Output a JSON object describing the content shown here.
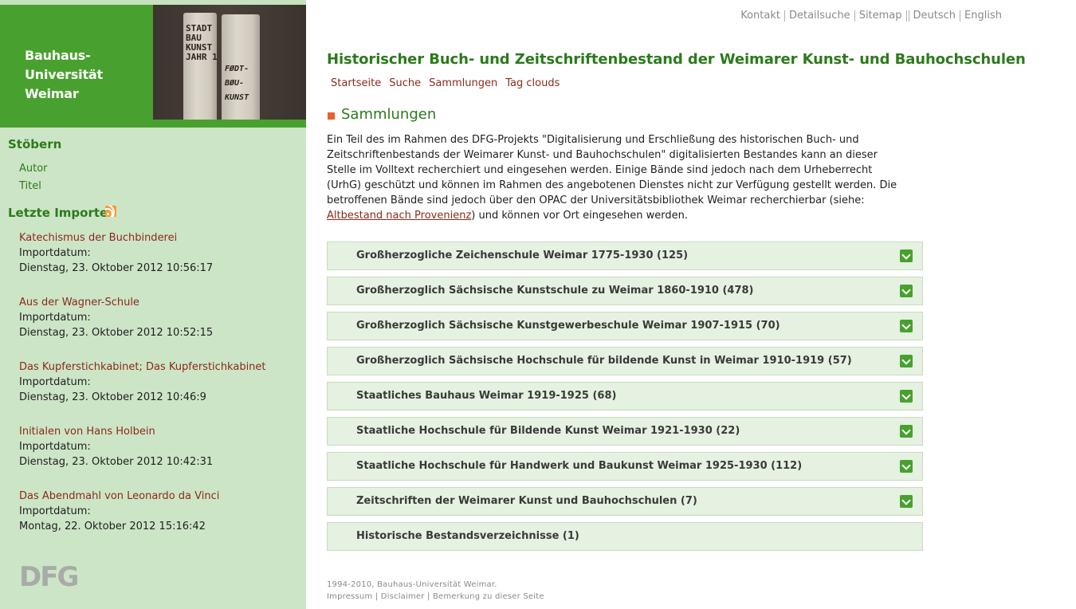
{
  "logo": {
    "text_line1": "Bauhaus-",
    "text_line2": "Universität",
    "text_line3": "Weimar",
    "photo_spine1": "STADT BAU KUNST JAHR 1",
    "photo_spine2": "FØDT- BØU- KUNST",
    "dfg": "DFG"
  },
  "colors": {
    "brand_green": "#48a12e",
    "sidebar_bg": "#cde5c7",
    "heading_green": "#2c7a1c",
    "link_red": "#8b2a1a",
    "bullet_orange": "#e8612c",
    "row_bg": "#e5f1e1"
  },
  "sidebar": {
    "browse_heading": "Stöbern",
    "browse_links": [
      "Autor",
      "Titel"
    ],
    "imports_heading": "Letzte Importe",
    "rss_icon": "rss-feed-icon",
    "imports": [
      {
        "title": "Katechismus der Buchbinderei",
        "label": "Importdatum:",
        "date": "Dienstag, 23. Oktober 2012 10:56:17"
      },
      {
        "title": "Aus der Wagner-Schule",
        "label": "Importdatum:",
        "date": "Dienstag, 23. Oktober 2012 10:52:15"
      },
      {
        "title": "Das Kupferstichkabinet; Das Kupferstichkabinet",
        "label": "Importdatum:",
        "date": "Dienstag, 23. Oktober 2012 10:46:9"
      },
      {
        "title": "Initialen von Hans Holbein",
        "label": "Importdatum:",
        "date": "Dienstag, 23. Oktober 2012 10:42:31"
      },
      {
        "title": "Das Abendmahl von Leonardo da Vinci",
        "label": "Importdatum:",
        "date": "Montag, 22. Oktober 2012 15:16:42"
      }
    ]
  },
  "top_nav": [
    "Kontakt",
    "Detailsuche",
    "Sitemap",
    "Deutsch",
    "English"
  ],
  "main": {
    "title": "Historischer Buch- und Zeitschriftenbestand der Weimarer Kunst- und Bauhochschulen",
    "breadcrumb": [
      "Startseite",
      "Suche",
      "Sammlungen",
      "Tag clouds"
    ],
    "section_title": "Sammlungen",
    "intro_before_link": "Ein Teil des im Rahmen des DFG-Projekts \"Digitalisierung und Erschließung des historischen Buch- und Zeitschriftenbestands der Weimarer Kunst- und Bauhochschulen\" digitalisierten Bestandes kann an dieser Stelle im Volltext recherchiert und eingesehen werden. Einige Bände sind jedoch nach dem Urheberrecht (UrhG) geschützt und können im Rahmen des angebotenen Dienstes nicht zur Verfügung gestellt werden. Die betroffenen Bände sind jedoch über den OPAC der Universitätsbibliothek Weimar recherchierbar (siehe: ",
    "intro_link": "Altbestand nach Provenienz",
    "intro_after_link": ") und können vor Ort eingesehen werden.",
    "collections": [
      {
        "label": "Großherzogliche Zeichenschule Weimar 1775-1930 (125)",
        "expandable": true
      },
      {
        "label": "Großherzoglich Sächsische Kunstschule zu Weimar 1860-1910 (478)",
        "expandable": true
      },
      {
        "label": "Großherzoglich Sächsische Kunstgewerbeschule Weimar 1907-1915 (70)",
        "expandable": true
      },
      {
        "label": "Großherzoglich Sächsische Hochschule für bildende Kunst in Weimar 1910-1919 (57)",
        "expandable": true
      },
      {
        "label": "Staatliches Bauhaus Weimar 1919-1925 (68)",
        "expandable": true
      },
      {
        "label": "Staatliche Hochschule für Bildende Kunst Weimar 1921-1930 (22)",
        "expandable": true
      },
      {
        "label": "Staatliche Hochschule für Handwerk und Baukunst Weimar 1925-1930 (112)",
        "expandable": true
      },
      {
        "label": "Zeitschriften der Weimarer Kunst und Bauhochschulen (7)",
        "expandable": true
      },
      {
        "label": "Historische Bestandsverzeichnisse (1)",
        "expandable": false
      }
    ]
  },
  "footer": {
    "copyright": "1994-2010, Bauhaus-Universität Weimar.",
    "links": [
      "Impressum",
      "Disclaimer",
      "Bemerkung zu dieser Seite"
    ]
  }
}
